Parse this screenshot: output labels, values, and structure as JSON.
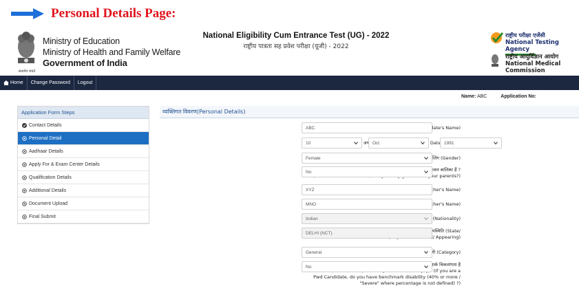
{
  "page_heading": "Personal Details Page:",
  "header": {
    "emblem_caption": "सत्यमेव जयते",
    "ministry_line1": "Ministry of Education",
    "ministry_line2": "Ministry of Health and Family Welfare",
    "ministry_line3": "Government of India",
    "exam_title_en": "National Eligibility Cum Entrance Test (UG) - 2022",
    "exam_title_hi": "राष्ट्रीय पात्रता सह प्रवेश परीक्षा (यूजी) - 2022",
    "nta_hi": "राष्ट्रीय परीक्षा एजेंसी",
    "nta_en": "National Testing Agency",
    "nmc_hi": "राष्ट्रीय आयुर्विज्ञान आयोग",
    "nmc_en": "National Medical Commission"
  },
  "nav": {
    "home": "Home",
    "change_password": "Change Password",
    "logout": "Logout"
  },
  "namebar": {
    "name_label": "Name:",
    "name_value": "ABC",
    "appno_label": "Application No:"
  },
  "steps": {
    "title": "Application Form Steps",
    "items": [
      {
        "label": "Contact Details"
      },
      {
        "label": "Personal Detail"
      },
      {
        "label": "Aadhaar Details"
      },
      {
        "label": "Apply For & Exam Center Details"
      },
      {
        "label": "Qualification Details"
      },
      {
        "label": "Additional Details"
      },
      {
        "label": "Document Upload"
      },
      {
        "label": "Final Submit"
      }
    ]
  },
  "form": {
    "title": "व्यक्तिगत विवरण(Personal Details)",
    "name_label": "अभ्यर्थी का नाम (Candidate's Name)",
    "name_value": "ABC",
    "dob_label": "अभ्यर्थी की जन्म तिथि (Candidate's Date of Birth)",
    "dob_day": "10",
    "dob_month": "Oct",
    "dob_year": "1991",
    "gender_label": "लिंग (Gender)",
    "gender_value": "Female",
    "girl_label_hi": "अगर अभ्यर्थी लड़की है तो, क्या आप अपने माता पिता की केवल बालिका हैं ?",
    "girl_label_en": "(In case of Girl candidate, Are you only girl child of your parents?)",
    "girl_value": "No",
    "father_label": "पिता का नाम (Father's Name)",
    "father_value": "XYZ",
    "mother_label": "माता का नाम (Mother's Name)",
    "mother_value": "MNO",
    "nationality_label": "राष्ट्रीयता (Nationality)",
    "nationality_value": "Indian",
    "state_label_hi": "राज्य / केन्द्र शासित प्रदेश जहां से 12 वीं / समकक्ष उत्तीर्ण / उपस्थिति (State/",
    "state_label_en": "UT from where 12th/ Equivalent Passed/ Appearing)",
    "state_value": "DELHI (NCT)",
    "category_label": "श्रेणी (Category)",
    "category_value": "General",
    "pwd_label_1": "यदि आप एक Pwd उम्मीदवार है, तो क्या आपके पास बेंचमार्क विकलांगता है",
    "pwd_label_2": "(40% या अधिक / \"गंभीर\" जहां प्रतिशत परिभाषित नहीं है)? (If you are a",
    "pwd_label_3": "Pwd Candidate, do you have benchmark disability (40% or more /",
    "pwd_label_4": "\"Severe\" where percentage is not defined) ?)",
    "pwd_value": "No"
  }
}
